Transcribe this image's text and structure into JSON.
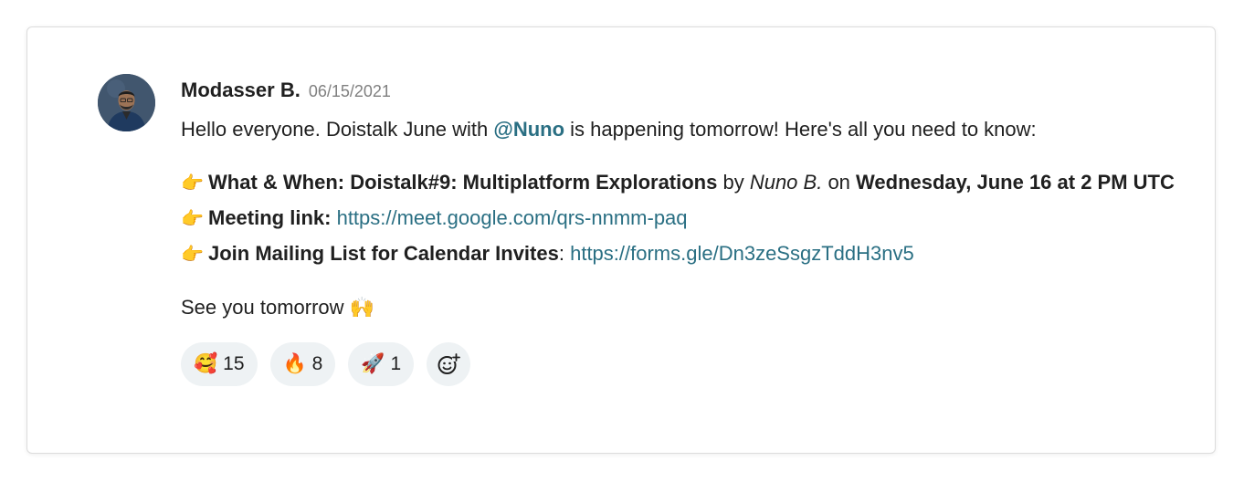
{
  "message": {
    "author": "Modasser B.",
    "date": "06/15/2021",
    "intro_before": "Hello everyone. Doistalk June with ",
    "mention": "@Nuno",
    "intro_after": " is happening tomorrow! Here's all you need to know:",
    "bullet_icon": "pointing-hand-icon",
    "bullet_glyph": "👉",
    "what_label": "What & When: Doistalk#9: Multiplatform Explorations",
    "by_text": " by ",
    "speaker": "Nuno B.",
    "on_text": " on ",
    "when": "Wednesday, June 16 at 2 PM UTC",
    "meeting_label": "Meeting link:",
    "meeting_url": "https://meet.google.com/qrs-nnmm-paq",
    "mailing_label": "Join Mailing List for Calendar Invites",
    "mailing_colon": ":",
    "mailing_url": "https://forms.gle/Dn3zeSsgzTddH3nv5",
    "closing_text": "See you tomorrow ",
    "closing_emoji": "🙌"
  },
  "reactions": [
    {
      "emoji": "🥰",
      "icon": "smiling-face-with-hearts-icon",
      "count": "15"
    },
    {
      "emoji": "🔥",
      "icon": "fire-icon",
      "count": "8"
    },
    {
      "emoji": "🚀",
      "icon": "rocket-icon",
      "count": "1"
    }
  ],
  "colors": {
    "link": "#2a6f83",
    "reaction_bg": "#eef2f4",
    "border": "#dcdcdc",
    "date": "#808080"
  }
}
